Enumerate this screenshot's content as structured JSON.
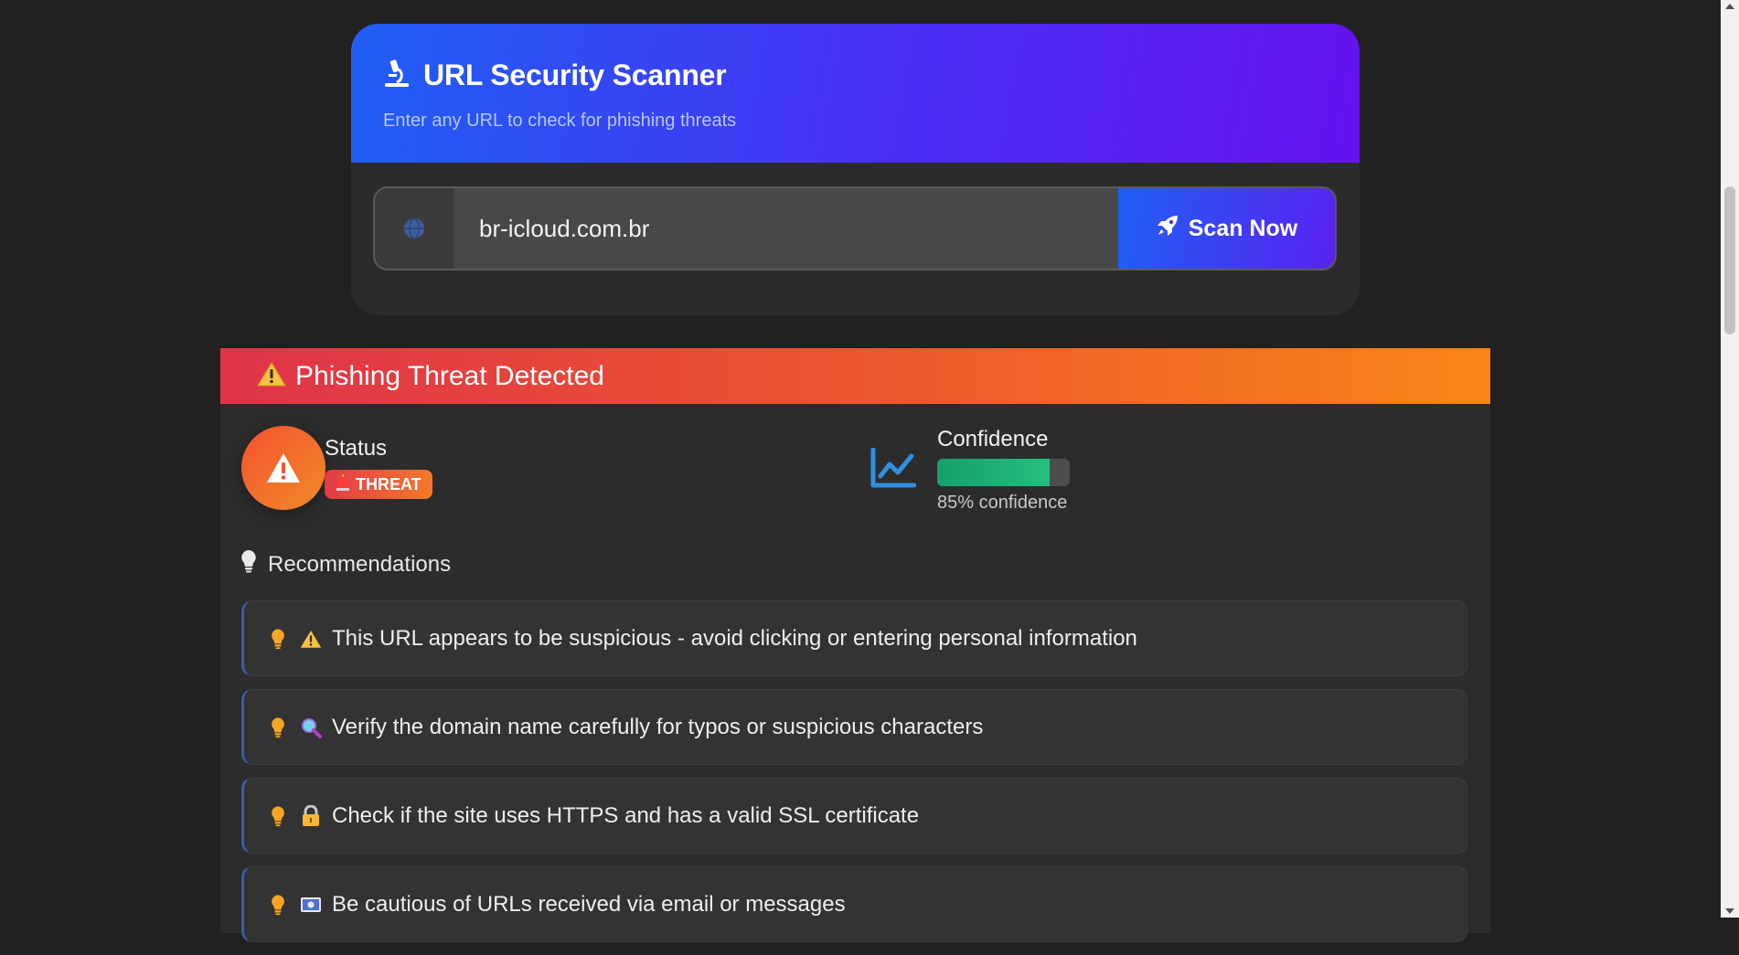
{
  "scanner": {
    "title": "URL Security Scanner",
    "subtitle": "Enter any URL to check for phishing threats",
    "url_value": "br-icloud.com.br",
    "scan_button": "Scan Now",
    "icons": {
      "title": "microscope-icon",
      "input": "globe-icon",
      "button": "rocket-icon"
    }
  },
  "result": {
    "title": "Phishing Threat Detected",
    "status_label": "Status",
    "status_badge": "THREAT",
    "confidence_label": "Confidence",
    "confidence_value": 0.85,
    "confidence_text": "85% confidence",
    "recommendations_heading": "Recommendations",
    "recommendations": [
      {
        "icon": "warning-emoji",
        "text": "This URL appears to be suspicious - avoid clicking or entering personal information"
      },
      {
        "icon": "magnifier-emoji",
        "text": "Verify the domain name carefully for typos or suspicious characters"
      },
      {
        "icon": "lock-emoji",
        "text": "Check if the site uses HTTPS and has a valid SSL certificate"
      },
      {
        "icon": "envelope-emoji",
        "text": "Be cautious of URLs received via email or messages"
      }
    ]
  },
  "colors": {
    "background": "#212121",
    "header_gradient": [
      "#1f5ff5",
      "#6512ee"
    ],
    "threat_gradient": [
      "#e0334a",
      "#fb8517"
    ],
    "confidence_fill": "#1fb578",
    "recommendation_icon": "#f5a623"
  }
}
